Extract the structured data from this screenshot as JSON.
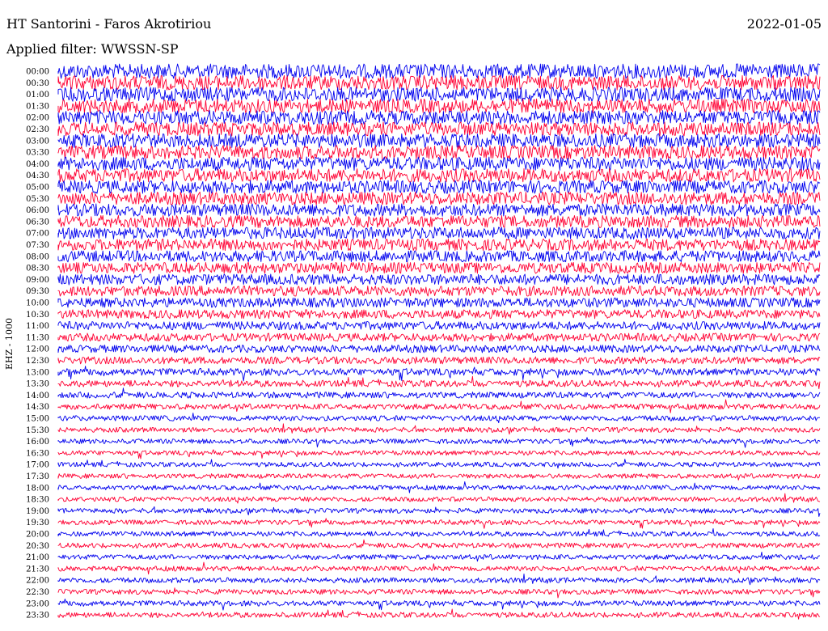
{
  "header": {
    "station": "HT Santorini - Faros Akrotiriou",
    "date": "2022-01-05",
    "filter": "Applied filter: WWSSN-SP",
    "channel": "EHZ - 1000"
  },
  "chart_data": {
    "type": "helicorder",
    "title": "HT Santorini - Faros Akrotiriou",
    "date": "2022-01-05",
    "filter": "WWSSN-SP",
    "ylabel": "EHZ - 1000",
    "row_labels": [
      "00:00",
      "00:30",
      "01:00",
      "01:30",
      "02:00",
      "02:30",
      "03:00",
      "03:30",
      "04:00",
      "04:30",
      "05:00",
      "05:30",
      "06:00",
      "06:30",
      "07:00",
      "07:30",
      "08:00",
      "08:30",
      "09:00",
      "09:30",
      "10:00",
      "10:30",
      "11:00",
      "11:30",
      "12:00",
      "12:30",
      "13:00",
      "13:30",
      "14:00",
      "14:30",
      "15:00",
      "15:30",
      "16:00",
      "16:30",
      "17:00",
      "17:30",
      "18:00",
      "18:30",
      "19:00",
      "19:30",
      "20:00",
      "20:30",
      "21:00",
      "21:30",
      "22:00",
      "22:30",
      "23:00",
      "23:30"
    ],
    "trace_colors": [
      "#0000ee",
      "#ff0033"
    ],
    "relative_amplitude": [
      1.0,
      1.0,
      0.98,
      0.97,
      0.96,
      0.95,
      0.95,
      0.94,
      0.93,
      0.92,
      0.9,
      0.88,
      0.86,
      0.84,
      0.82,
      0.8,
      0.78,
      0.76,
      0.74,
      0.7,
      0.66,
      0.62,
      0.58,
      0.55,
      0.52,
      0.5,
      0.48,
      0.45,
      0.42,
      0.38,
      0.36,
      0.34,
      0.33,
      0.32,
      0.32,
      0.32,
      0.32,
      0.32,
      0.33,
      0.33,
      0.33,
      0.34,
      0.34,
      0.34,
      0.35,
      0.35,
      0.36,
      0.36
    ]
  }
}
